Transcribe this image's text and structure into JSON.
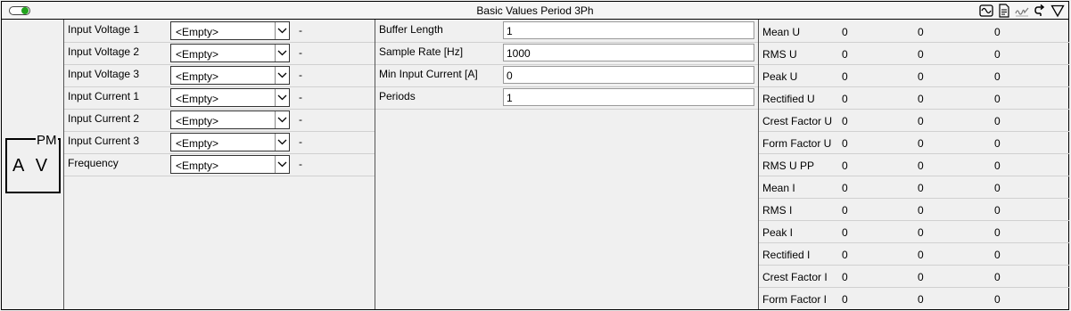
{
  "window": {
    "title": "Basic Values Period 3Ph",
    "toggle_on": true,
    "accent": "#22a31d"
  },
  "toolbar_icons": [
    "waveform-icon",
    "document-icon",
    "signature-icon",
    "redo-arrow-icon",
    "filter-icon"
  ],
  "logo": {
    "top_label": "PM",
    "main_label": "A V"
  },
  "inputs": [
    {
      "label": "Input Voltage 1",
      "value": "<Empty>",
      "status": "-"
    },
    {
      "label": "Input Voltage 2",
      "value": "<Empty>",
      "status": "-"
    },
    {
      "label": "Input Voltage 3",
      "value": "<Empty>",
      "status": "-"
    },
    {
      "label": "Input Current 1",
      "value": "<Empty>",
      "status": "-"
    },
    {
      "label": "Input Current 2",
      "value": "<Empty>",
      "status": "-"
    },
    {
      "label": "Input Current 3",
      "value": "<Empty>",
      "status": "-"
    },
    {
      "label": "Frequency",
      "value": "<Empty>",
      "status": "-"
    }
  ],
  "params": [
    {
      "label": "Buffer Length",
      "value": "1"
    },
    {
      "label": "Sample Rate [Hz]",
      "value": "1000"
    },
    {
      "label": "Min Input Current [A]",
      "value": "0"
    },
    {
      "label": "Periods",
      "value": "1"
    }
  ],
  "results": [
    {
      "label": "Mean U",
      "values": [
        "0",
        "0",
        "0"
      ]
    },
    {
      "label": "RMS U",
      "values": [
        "0",
        "0",
        "0"
      ]
    },
    {
      "label": "Peak U",
      "values": [
        "0",
        "0",
        "0"
      ]
    },
    {
      "label": "Rectified U",
      "values": [
        "0",
        "0",
        "0"
      ]
    },
    {
      "label": "Crest Factor U",
      "values": [
        "0",
        "0",
        "0"
      ]
    },
    {
      "label": "Form Factor U",
      "values": [
        "0",
        "0",
        "0"
      ]
    },
    {
      "label": "RMS U PP",
      "values": [
        "0",
        "0",
        "0"
      ]
    },
    {
      "label": "Mean I",
      "values": [
        "0",
        "0",
        "0"
      ]
    },
    {
      "label": "RMS I",
      "values": [
        "0",
        "0",
        "0"
      ]
    },
    {
      "label": "Peak I",
      "values": [
        "0",
        "0",
        "0"
      ]
    },
    {
      "label": "Rectified I",
      "values": [
        "0",
        "0",
        "0"
      ]
    },
    {
      "label": "Crest Factor I",
      "values": [
        "0",
        "0",
        "0"
      ]
    },
    {
      "label": "Form Factor I",
      "values": [
        "0",
        "0",
        "0"
      ]
    }
  ]
}
